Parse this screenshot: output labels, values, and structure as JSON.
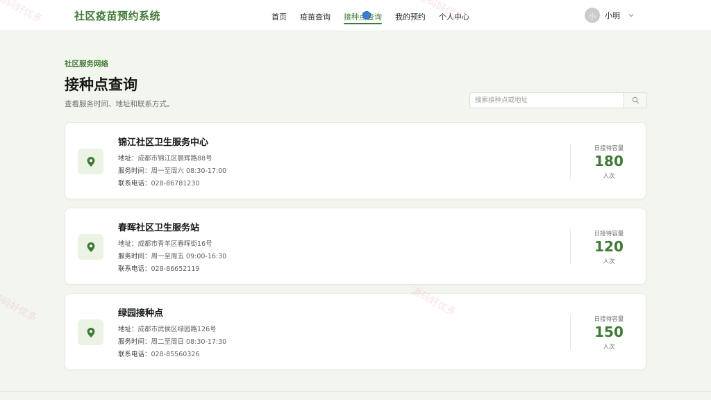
{
  "header": {
    "brand": "社区疫苗预约系统",
    "nav": [
      "首页",
      "疫苗查询",
      "接种点查询",
      "我的预约",
      "个人中心"
    ],
    "active_nav": "接种点查询",
    "user": {
      "avatar_text": "小",
      "name": "小明"
    }
  },
  "page": {
    "eyebrow": "社区服务网络",
    "title": "接种点查询",
    "subtitle": "查看服务时间、地址和联系方式。",
    "search_placeholder": "搜索接种点或地址"
  },
  "labels": {
    "address": "地址：",
    "hours": "服务时间：",
    "phone": "联系电话：",
    "capacity": "日接待容量",
    "unit": "人次"
  },
  "sites": [
    {
      "name": "锦江社区卫生服务中心",
      "address": "成都市锦江区晨辉路88号",
      "hours": "周一至周六 08:30-17:00",
      "phone": "028-86781230",
      "capacity": "180"
    },
    {
      "name": "春晖社区卫生服务站",
      "address": "成都市青羊区春晖街16号",
      "hours": "周一至周五 09:00-16:30",
      "phone": "028-86652119",
      "capacity": "120"
    },
    {
      "name": "绿园接种点",
      "address": "成都市武侯区绿园路126号",
      "hours": "周二至周日 08:30-17:30",
      "phone": "028-85560326",
      "capacity": "150"
    }
  ],
  "watermark": "源码好优多",
  "colors": {
    "accent": "#3f7a33",
    "background": "#f3f6ef",
    "pin_bg": "#eaf3e4"
  }
}
